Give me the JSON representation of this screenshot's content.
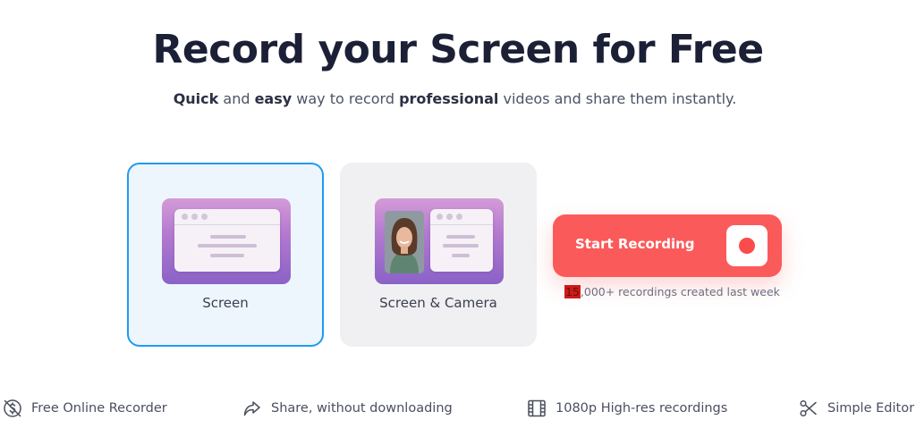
{
  "hero": {
    "title": "Record your Screen for Free",
    "subtitle": {
      "bold1": "Quick",
      "t1": " and ",
      "bold2": "easy",
      "t2": " way to record ",
      "bold3": "professional",
      "t3": " videos and share them instantly."
    }
  },
  "options": [
    {
      "label": "Screen",
      "selected": true,
      "icon": "screen-window-icon"
    },
    {
      "label": "Screen & Camera",
      "selected": false,
      "icon": "screen-camera-icon"
    }
  ],
  "record": {
    "button_label": "Start Recording",
    "icon": "record-dot-icon",
    "note_highlight": "15",
    "note_rest": ",000+ recordings created last week"
  },
  "features": [
    {
      "label": "Free Online Recorder",
      "icon": "no-cost-icon"
    },
    {
      "label": "Share, without downloading",
      "icon": "share-arrow-icon"
    },
    {
      "label": "1080p High-res recordings",
      "icon": "film-icon"
    },
    {
      "label": "Simple Editor",
      "icon": "scissors-icon"
    }
  ],
  "colors": {
    "selected_border": "#1f9bf0",
    "record_button": "#fb5a5a",
    "title_text": "#1b2036"
  }
}
